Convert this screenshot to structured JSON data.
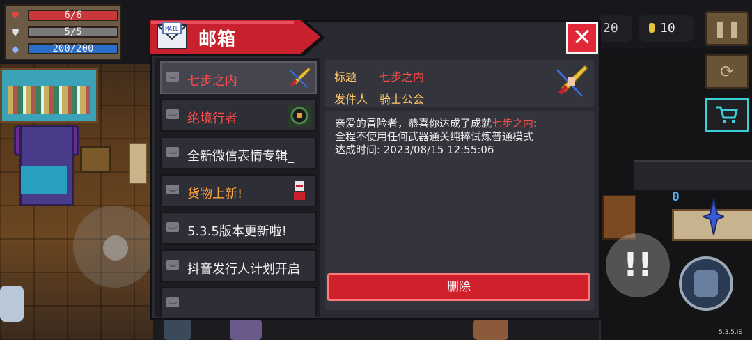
{
  "hud": {
    "hp_text": "6/6",
    "armor_text": "5/5",
    "energy_text": "200/200",
    "hp_icon": "heart-icon",
    "armor_icon": "shield-icon",
    "energy_icon": "diamond-icon"
  },
  "currency": {
    "gems_text": "20",
    "gold_text": "10"
  },
  "mailbox": {
    "title": "邮箱",
    "close_label": "✕",
    "items": [
      {
        "label": "七步之内",
        "color": "#ff4b4b",
        "thumb": "sword-icon"
      },
      {
        "label": "绝境行者",
        "color": "#ff4b4b",
        "thumb": "portal-icon"
      },
      {
        "label": "全新微信表情专辑_",
        "color": "#f2f2f2",
        "thumb": ""
      },
      {
        "label": "货物上新!",
        "color": "#ffa63a",
        "thumb": "merchant-icon"
      },
      {
        "label": "5.3.5版本更新啦!",
        "color": "#f2f2f2",
        "thumb": ""
      },
      {
        "label": "抖音发行人计划开启",
        "color": "#f2f2f2",
        "thumb": ""
      }
    ],
    "detail": {
      "title_label": "标题",
      "title_value": "七步之内",
      "sender_label": "发件人",
      "sender_value": "骑士公会",
      "body_prefix": "亲爱的冒险者，恭喜你达成了成就",
      "body_highlight": "七步之内",
      "body_colon": ":",
      "body_line2": "全程不使用任何武器通关纯粹试炼普通模式",
      "body_line3": "达成时间: 2023/08/15 12:55:06",
      "delete_label": "删除"
    }
  },
  "version": "5.3.5.IS"
}
